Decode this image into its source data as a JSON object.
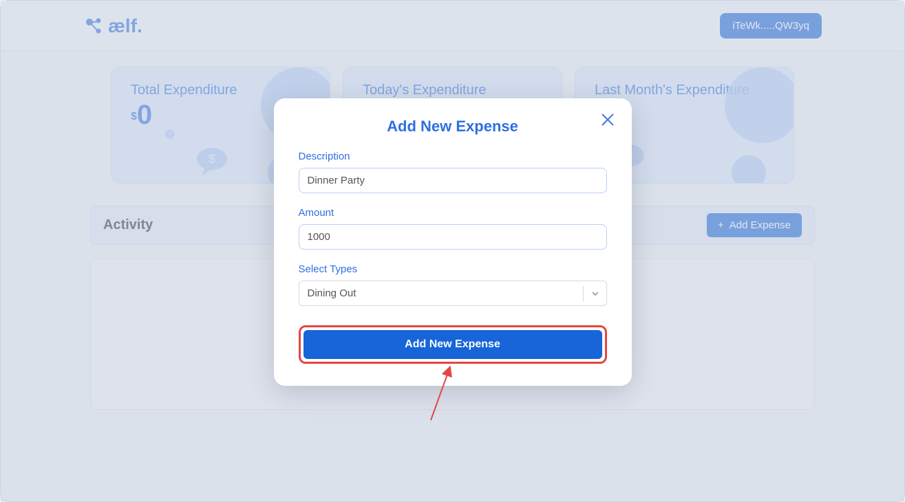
{
  "header": {
    "logo_text": "ælf.",
    "wallet_label": "iTeWk.....QW3yq"
  },
  "cards": {
    "total": {
      "title": "Total Expenditure",
      "currency": "$",
      "value": "0"
    },
    "today": {
      "title": "Today's Expenditure"
    },
    "last_month": {
      "title": "Last Month's Expenditure"
    }
  },
  "activity": {
    "title": "Activity",
    "add_button_label": "Add Expense",
    "add_button_icon": "+"
  },
  "modal": {
    "title": "Add New Expense",
    "description_label": "Description",
    "description_value": "Dinner Party",
    "amount_label": "Amount",
    "amount_value": "1000",
    "types_label": "Select Types",
    "types_value": "Dining Out",
    "submit_label": "Add New Expense"
  },
  "colors": {
    "primary": "#1765d8",
    "accent_text": "#2f6fe0",
    "highlight": "#e64545"
  }
}
